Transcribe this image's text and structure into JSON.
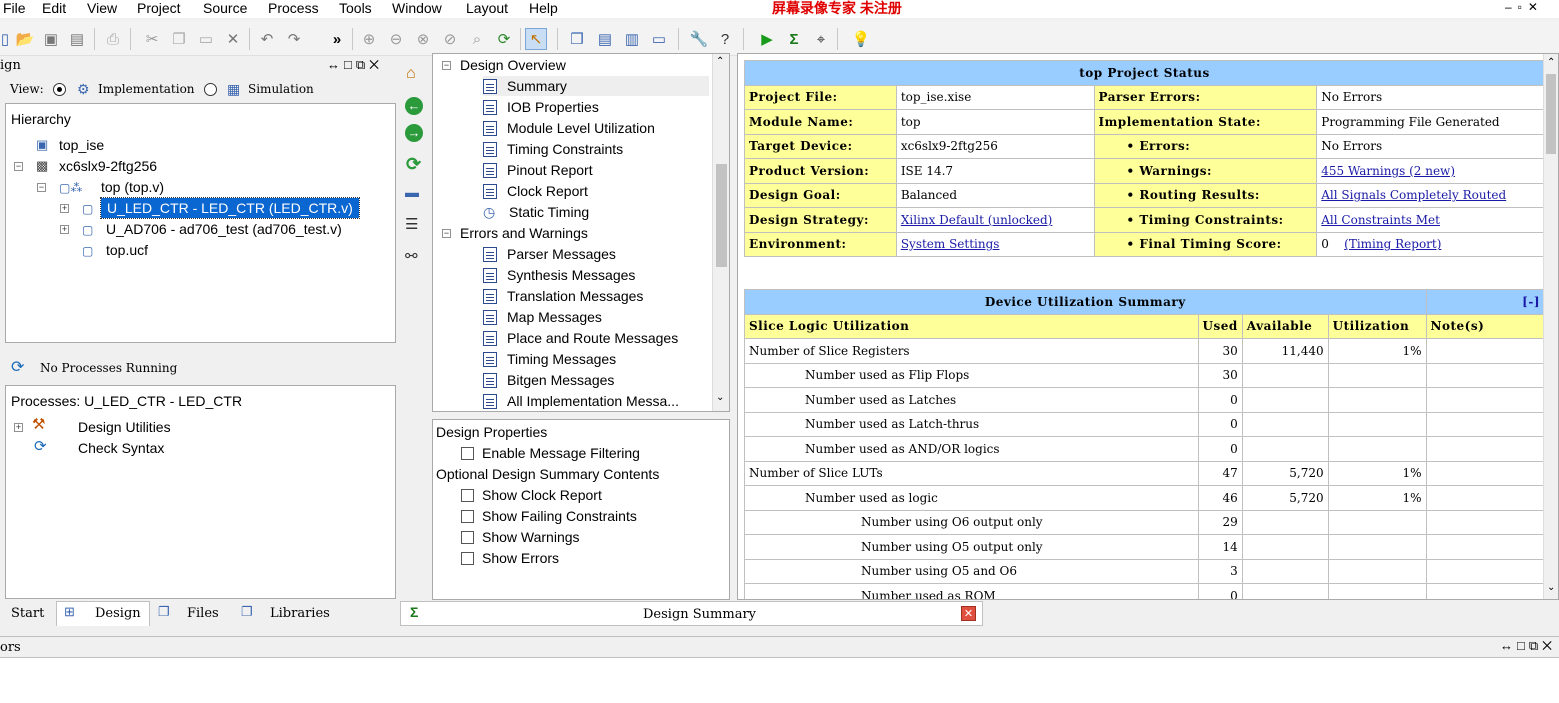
{
  "menu": {
    "items": [
      "File",
      "Edit",
      "View",
      "Project",
      "Source",
      "Process",
      "Tools",
      "Window",
      "Layout",
      "Help"
    ],
    "watermark": "屏幕录像专家 未注册"
  },
  "toolbar": {
    "icons": [
      "open-folder-icon",
      "save-icon",
      "save-all-icon",
      "print-icon",
      "cut-icon",
      "copy-icon",
      "paste-icon",
      "delete-icon",
      "undo-icon",
      "redo-icon",
      "more-icon",
      "zoom-in-icon",
      "zoom-out-icon",
      "zoom-fit-icon",
      "zoom-region-icon",
      "find-icon",
      "refresh-icon",
      "pointer-icon",
      "cascade-icon",
      "tile-horizontal-icon",
      "tile-vertical-icon",
      "float-icon",
      "wrench-icon",
      "help-context-icon",
      "run-icon",
      "sigma-icon",
      "telescope-icon",
      "bulb-icon"
    ]
  },
  "design_panel": {
    "title": "ign",
    "view_label": "View:",
    "implementation_label": "Implementation",
    "simulation_label": "Simulation",
    "hierarchy_label": "Hierarchy",
    "hierarchy": [
      "top_ise",
      "xc6slx9-2ftg256",
      "top (top.v)",
      "U_LED_CTR - LED_CTR (LED_CTR.v)",
      "U_AD706 - ad706_test (ad706_test.v)",
      "top.ucf"
    ],
    "no_processes": "No Processes Running",
    "processes_label": "Processes: U_LED_CTR - LED_CTR",
    "processes": [
      "Design Utilities",
      "Check Syntax"
    ]
  },
  "bottom_tabs": [
    "Start",
    "Design",
    "Files",
    "Libraries"
  ],
  "summary_tab": "Design Summary",
  "errors_label": "ors",
  "nav_tree": {
    "design_overview": "Design Overview",
    "overview_items": [
      "Summary",
      "IOB Properties",
      "Module Level Utilization",
      "Timing Constraints",
      "Pinout Report",
      "Clock Report",
      "Static Timing"
    ],
    "errors_warnings": "Errors and Warnings",
    "message_items": [
      "Parser Messages",
      "Synthesis Messages",
      "Translation Messages",
      "Map Messages",
      "Place and Route Messages",
      "Timing Messages",
      "Bitgen Messages",
      "All Implementation Messa..."
    ]
  },
  "properties": {
    "design_properties": "Design Properties",
    "enable_filtering": "Enable Message Filtering",
    "optional_contents": "Optional Design Summary Contents",
    "options": [
      "Show Clock Report",
      "Show Failing Constraints",
      "Show Warnings",
      "Show Errors"
    ]
  },
  "project_status": {
    "title": "top Project Status",
    "rows": [
      {
        "l1": "Project File:",
        "v1": "top_ise.xise",
        "l2": "Parser Errors:",
        "v2": "No Errors"
      },
      {
        "l1": "Module Name:",
        "v1": "top",
        "l2": "Implementation State:",
        "v2": "Programming File Generated"
      },
      {
        "l1": "Target Device:",
        "v1": "xc6slx9-2ftg256",
        "l2": "• Errors:",
        "v2": "No Errors"
      },
      {
        "l1": "Product Version:",
        "v1": "ISE 14.7",
        "l2": "• Warnings:",
        "v2": "455 Warnings (2 new)"
      },
      {
        "l1": "Design Goal:",
        "v1": "Balanced",
        "l2": "• Routing Results:",
        "v2": "All Signals Completely Routed"
      },
      {
        "l1": "Design Strategy:",
        "v1": "Xilinx Default (unlocked)",
        "l2": "• Timing Constraints:",
        "v2": "All Constraints Met"
      },
      {
        "l1": "Environment:",
        "v1": "System Settings",
        "l2": "• Final Timing Score:",
        "v2": "0",
        "v2b": "(Timing Report)"
      }
    ]
  },
  "utilization": {
    "title": "Device Utilization Summary",
    "collapse": "[-]",
    "headers": [
      "Slice Logic Utilization",
      "Used",
      "Available",
      "Utilization",
      "Note(s)"
    ],
    "rows": [
      {
        "name": "Number of Slice Registers",
        "used": "30",
        "avail": "11,440",
        "util": "1%",
        "indent": 0
      },
      {
        "name": "Number used as Flip Flops",
        "used": "30",
        "avail": "",
        "util": "",
        "indent": 1
      },
      {
        "name": "Number used as Latches",
        "used": "0",
        "avail": "",
        "util": "",
        "indent": 1
      },
      {
        "name": "Number used as Latch-thrus",
        "used": "0",
        "avail": "",
        "util": "",
        "indent": 1
      },
      {
        "name": "Number used as AND/OR logics",
        "used": "0",
        "avail": "",
        "util": "",
        "indent": 1
      },
      {
        "name": "Number of Slice LUTs",
        "used": "47",
        "avail": "5,720",
        "util": "1%",
        "indent": 0
      },
      {
        "name": "Number used as logic",
        "used": "46",
        "avail": "5,720",
        "util": "1%",
        "indent": 1
      },
      {
        "name": "Number using O6 output only",
        "used": "29",
        "avail": "",
        "util": "",
        "indent": 2
      },
      {
        "name": "Number using O5 output only",
        "used": "14",
        "avail": "",
        "util": "",
        "indent": 2
      },
      {
        "name": "Number using O5 and O6",
        "used": "3",
        "avail": "",
        "util": "",
        "indent": 2
      },
      {
        "name": "Number used as ROM",
        "used": "0",
        "avail": "",
        "util": "",
        "indent": 2
      }
    ]
  }
}
